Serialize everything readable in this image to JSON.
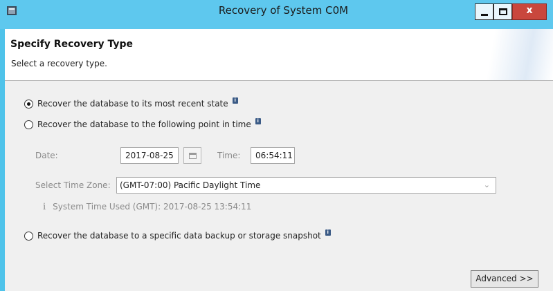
{
  "window": {
    "title": "Recovery of System C0M",
    "close_glyph": "x"
  },
  "header": {
    "title": "Specify Recovery Type",
    "subtitle": "Select a recovery type."
  },
  "options": {
    "most_recent": {
      "label": "Recover the database to its most recent state",
      "checked": true
    },
    "point_in_time": {
      "label": "Recover the database to the following point in time",
      "checked": false
    },
    "backup_snapshot": {
      "label": "Recover the database to a specific data backup or storage snapshot",
      "checked": false
    }
  },
  "point_in_time": {
    "date_label": "Date:",
    "date_value": "2017-08-25",
    "time_label": "Time:",
    "time_value": "06:54:11",
    "timezone_label": "Select Time Zone:",
    "timezone_value": "(GMT-07:00) Pacific Daylight Time",
    "system_time_note": "System Time Used (GMT): 2017-08-25 13:54:11"
  },
  "buttons": {
    "advanced": "Advanced >>"
  },
  "colors": {
    "titlebar": "#5ec8ee",
    "close_button": "#c9473d",
    "info_icon": "#3b5b86"
  },
  "icons": [
    "app-icon",
    "minimize-icon",
    "maximize-icon",
    "close-icon",
    "info-icon",
    "calendar-icon",
    "chevron-down-icon"
  ]
}
